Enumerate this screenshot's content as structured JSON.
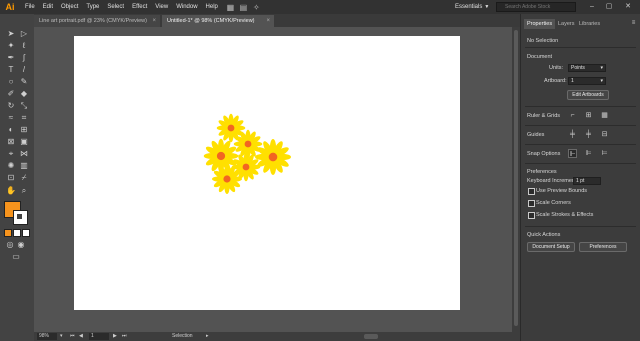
{
  "app": {
    "logo": "Ai"
  },
  "menubar": {
    "items": [
      "File",
      "Edit",
      "Object",
      "Type",
      "Select",
      "Effect",
      "View",
      "Window",
      "Help"
    ],
    "workspace": "Essentials",
    "search_placeholder": "Search Adobe Stock"
  },
  "tabs": [
    {
      "label": "Line art portrait.pdf @ 23% (CMYK/Preview)",
      "close": "×"
    },
    {
      "label": "Untitled-1* @ 98% (CMYK/Preview)",
      "close": "×"
    }
  ],
  "status": {
    "zoom": "98%",
    "artboard": "1",
    "tool": "Selection"
  },
  "panel": {
    "tabs": [
      "Properties",
      "Layers",
      "Libraries"
    ],
    "no_selection": "No Selection",
    "document_heading": "Document",
    "units_label": "Units:",
    "units_value": "Points",
    "artboard_label": "Artboard:",
    "artboard_value": "1",
    "edit_artboards": "Edit Artboards",
    "ruler_heading": "Ruler & Grids",
    "guides_heading": "Guides",
    "snap_heading": "Snap Options",
    "preferences_heading": "Preferences",
    "keyboard_increment_label": "Keyboard Increment:",
    "keyboard_increment_value": "1 pt",
    "use_preview_bounds": "Use Preview Bounds",
    "scale_corners": "Scale Corners",
    "scale_strokes": "Scale Strokes & Effects",
    "quick_actions_heading": "Quick Actions",
    "document_setup": "Document Setup",
    "preferences_button": "Preferences"
  },
  "colors": {
    "fill": "#f7941d",
    "stroke": "#ffffff",
    "petal": "#ffe000",
    "center": "#f26522"
  },
  "artwork": {
    "description_icon": "flower-icon",
    "flower_count": 6
  }
}
